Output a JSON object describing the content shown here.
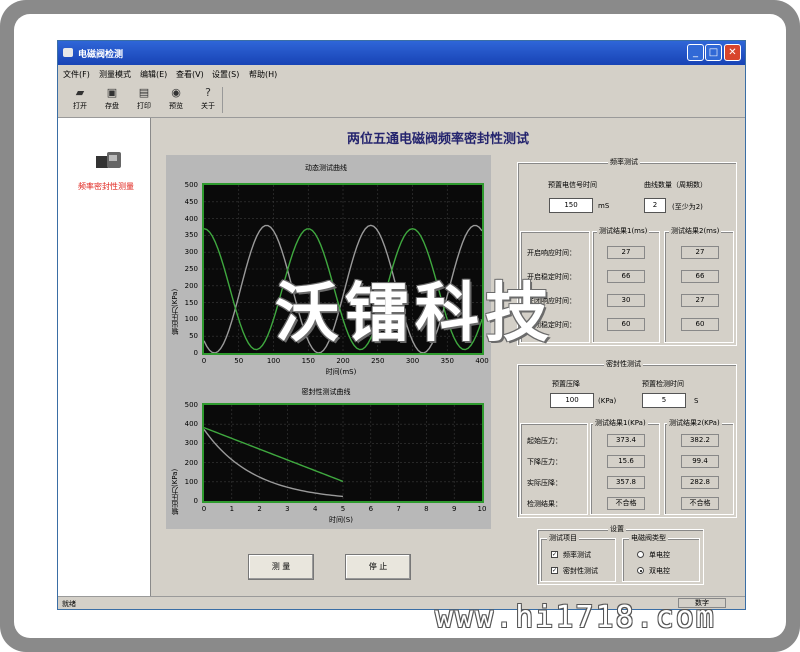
{
  "window": {
    "title": "电磁阀检测",
    "status_left": "就绪",
    "status_right": "数字"
  },
  "menu": [
    "文件(F)",
    "测量模式",
    "编辑(E)",
    "查看(V)",
    "设置(S)",
    "帮助(H)"
  ],
  "toolbar": [
    {
      "label": "打开",
      "icon": "open-folder-icon"
    },
    {
      "label": "存盘",
      "icon": "save-disk-icon"
    },
    {
      "label": "打印",
      "icon": "printer-icon"
    },
    {
      "label": "预览",
      "icon": "preview-icon"
    },
    {
      "label": "关于",
      "icon": "help-icon"
    }
  ],
  "sidebar": {
    "label": "频率密封性测量"
  },
  "main_title": "两位五通电磁阀频率密封性测试",
  "chart1": {
    "title": "动态测试曲线",
    "ylabel": "输出压力(KPa)",
    "xlabel": "时间(mS)",
    "yticks": [
      "500",
      "450",
      "400",
      "350",
      "300",
      "250",
      "200",
      "150",
      "100",
      "50",
      "0"
    ],
    "xticks": [
      "0",
      "50",
      "100",
      "150",
      "200",
      "250",
      "300",
      "350",
      "400"
    ]
  },
  "chart2": {
    "title": "密封性测试曲线",
    "ylabel": "输出压力(KPa)",
    "xlabel": "时间(S)",
    "yticks": [
      "500",
      "400",
      "300",
      "200",
      "100",
      "0"
    ],
    "xticks": [
      "0",
      "1",
      "2",
      "3",
      "4",
      "5",
      "6",
      "7",
      "8",
      "9",
      "10"
    ]
  },
  "freq_test": {
    "title": "频率测试",
    "signal_time_label": "预置电信号时间",
    "signal_time_value": "150",
    "signal_time_unit": "mS",
    "curve_count_label": "曲线数量（周期数）",
    "curve_count_value": "2",
    "curve_count_note": "(至少为2)",
    "result1_title": "测试结果1(ms)",
    "result2_title": "测试结果2(ms)",
    "rows": [
      {
        "label": "开启响应时间：",
        "r1": "27",
        "r2": "27"
      },
      {
        "label": "开启稳定时间：",
        "r1": "66",
        "r2": "66"
      },
      {
        "label": "关闭响应时间：",
        "r1": "30",
        "r2": "27"
      },
      {
        "label": "关闭稳定时间：",
        "r1": "60",
        "r2": "60"
      }
    ]
  },
  "seal_test": {
    "title": "密封性测试",
    "preset_drop_label": "预置压降",
    "preset_drop_value": "100",
    "preset_drop_unit": "(KPa)",
    "detect_time_label": "预置检测时间",
    "detect_time_value": "5",
    "detect_time_unit": "S",
    "result1_title": "测试结果1(KPa)",
    "result2_title": "测试结果2(KPa)",
    "rows": [
      {
        "label": "起始压力：",
        "r1": "373.4",
        "r2": "382.2"
      },
      {
        "label": "下降压力：",
        "r1": "15.6",
        "r2": "99.4"
      },
      {
        "label": "实际压降：",
        "r1": "357.8",
        "r2": "282.8"
      },
      {
        "label": "检测结果：",
        "r1": "不合格",
        "r2": "不合格"
      }
    ]
  },
  "settings": {
    "title": "设置",
    "items_title": "测试项目",
    "item_freq": "频率测试",
    "item_seal": "密封性测试",
    "type_title": "电磁阀类型",
    "type_single": "单电控",
    "type_double": "双电控"
  },
  "buttons": {
    "measure": "测 量",
    "stop": "停 止"
  },
  "watermark": "沃镭科技",
  "site_watermark": "www.hi1718.com",
  "colors": {
    "plot_bg": "#0a0a0a",
    "plot_border": "#2e9a2e",
    "curve_green": "#3fa83f",
    "curve_gray": "#9a9a9a",
    "title_blue": "#24246e",
    "sidebar_red": "#e0211a"
  }
}
